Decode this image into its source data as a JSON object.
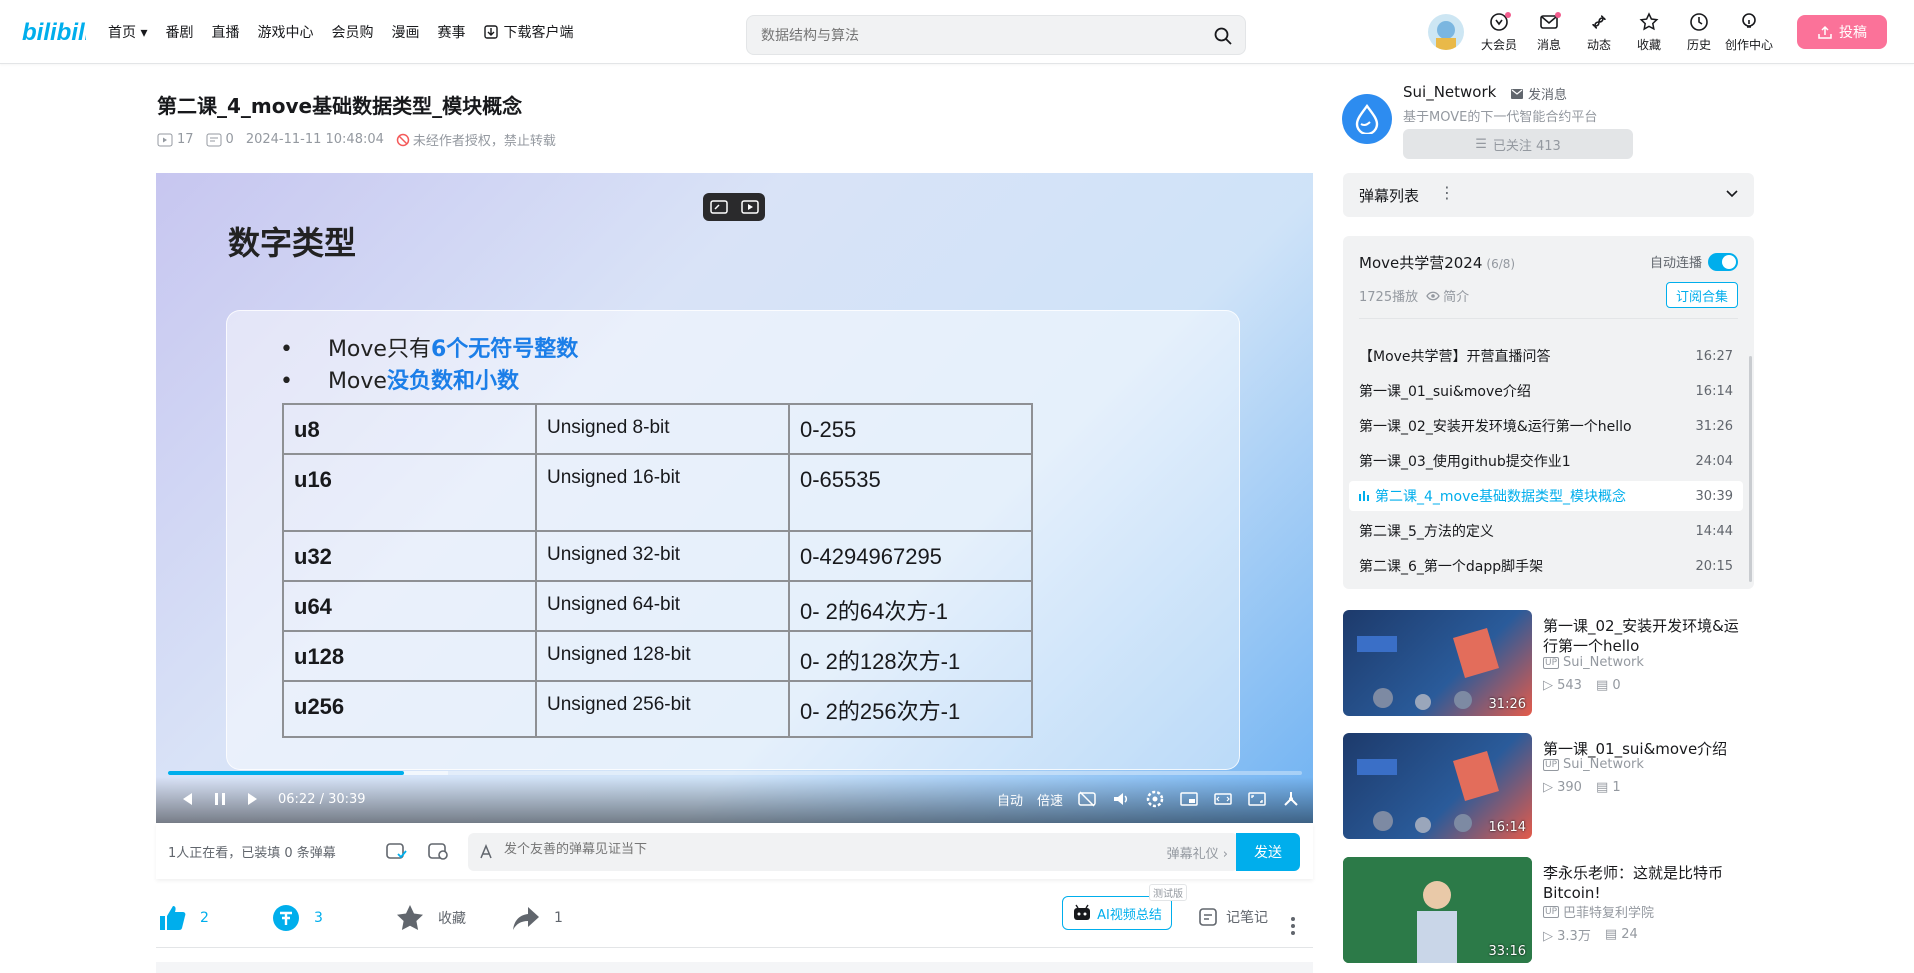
{
  "nav": {
    "home": "首页",
    "items": [
      "番剧",
      "直播",
      "游戏中心",
      "会员购",
      "漫画",
      "赛事"
    ],
    "download": "下载客户端"
  },
  "search": {
    "placeholder": "数据结构与算法"
  },
  "right_nav": [
    "大会员",
    "消息",
    "动态",
    "收藏",
    "历史",
    "创作中心"
  ],
  "upload_label": "投稿",
  "video": {
    "title": "第二课_4_move基础数据类型_模块概念",
    "plays": "17",
    "danmaku": "0",
    "date": "2024-11-11 10:48:04",
    "copyright": "未经作者授权，禁止转载"
  },
  "slide": {
    "title": "数字类型",
    "bullet1_pre": "Move只有",
    "bullet1_hl": "6个无符号整数",
    "bullet2_pre": "Move",
    "bullet2_hl": "没负数和小数",
    "rows": [
      [
        "u8",
        "Unsigned 8-bit",
        "0-255"
      ],
      [
        "u16",
        "Unsigned 16-bit",
        "0-65535"
      ],
      [
        "u32",
        "Unsigned 32-bit",
        "0-4294967295"
      ],
      [
        "u64",
        "Unsigned 64-bit",
        "0- 2的64次方-1"
      ],
      [
        "u128",
        "Unsigned 128-bit",
        "0- 2的128次方-1"
      ],
      [
        "u256",
        "Unsigned 256-bit",
        "0- 2的256次方-1"
      ]
    ]
  },
  "player": {
    "time": "06:22 / 30:39",
    "progress": 0.208,
    "auto": "自动",
    "speed": "倍速"
  },
  "danmaku_bar": {
    "watching": "1人正在看，已装填 0 条弹幕",
    "placeholder": "发个友善的弹幕见证当下",
    "etiquette": "弹幕礼仪 ›",
    "send": "发送"
  },
  "actions": {
    "like": "2",
    "coin": "3",
    "fav": "收藏",
    "share": "1",
    "ai": "AI视频总结",
    "ai_tag": "测试版",
    "note": "记笔记"
  },
  "up": {
    "name": "Sui_Network",
    "msg": "发消息",
    "desc": "基于MOVE的下一代智能合约平台",
    "followed": "已关注 413"
  },
  "danmaku_list": "弹幕列表",
  "collection": {
    "title": "Move共学营2024",
    "count": "(6/8)",
    "auto": "自动连播",
    "plays": "1725播放",
    "intro": "简介",
    "subscribe": "订阅合集",
    "episodes": [
      {
        "t": "【Move共学营】开营直播问答",
        "d": "16:27"
      },
      {
        "t": "第一课_01_sui&move介绍",
        "d": "16:14"
      },
      {
        "t": "第一课_02_安装开发环境&运行第一个hello",
        "d": "31:26"
      },
      {
        "t": "第一课_03_使用github提交作业1",
        "d": "24:04"
      },
      {
        "t": "第二课_4_move基础数据类型_模块概念",
        "d": "30:39"
      },
      {
        "t": "第二课_5_方法的定义",
        "d": "14:44"
      },
      {
        "t": "第二课_6_第一个dapp脚手架",
        "d": "20:15"
      }
    ]
  },
  "recs": [
    {
      "title": "第一课_02_安装开发环境&运行第一个hello",
      "up": "Sui_Network",
      "plays": "543",
      "dm": "0",
      "dur": "31:26"
    },
    {
      "title": "第一课_01_sui&move介绍",
      "up": "Sui_Network",
      "plays": "390",
      "dm": "1",
      "dur": "16:14"
    },
    {
      "title": "李永乐老师：这就是比特币Bitcoin!",
      "up": "巴菲特复利学院",
      "plays": "3.3万",
      "dm": "24",
      "dur": "33:16"
    }
  ],
  "colors": {
    "brand": "#00aeec",
    "pink": "#fb7299"
  }
}
